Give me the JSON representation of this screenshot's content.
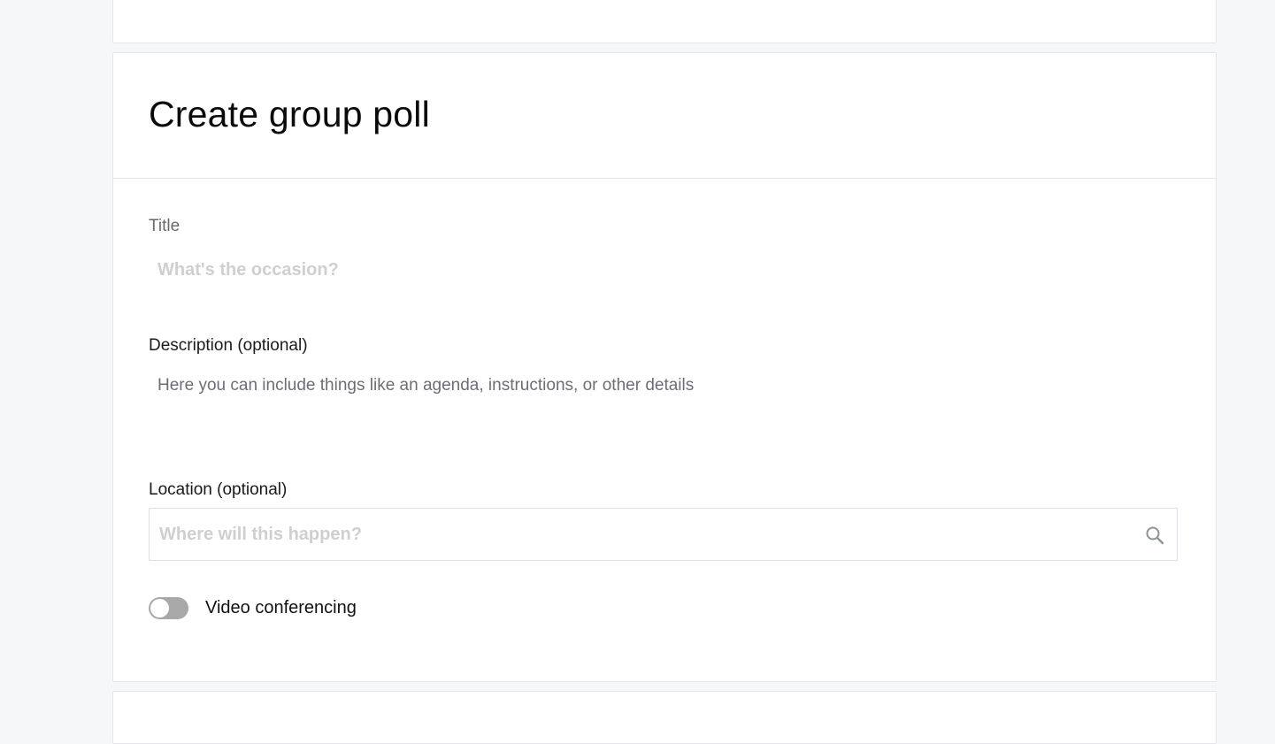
{
  "form": {
    "heading": "Create group poll",
    "title": {
      "label": "Title",
      "placeholder": "What's the occasion?",
      "value": ""
    },
    "description": {
      "label": "Description (optional)",
      "placeholder": "Here you can include things like an agenda, instructions, or other details",
      "value": ""
    },
    "location": {
      "label": "Location (optional)",
      "placeholder": "Where will this happen?",
      "value": "",
      "icon": "search-icon"
    },
    "video_conferencing": {
      "label": "Video conferencing",
      "enabled": false
    }
  },
  "colors": {
    "background": "#f6f7f9",
    "card": "#ffffff",
    "border": "#e4e6ea",
    "toggle_off": "#a8a8a8",
    "placeholder": "#cfcfcf"
  }
}
